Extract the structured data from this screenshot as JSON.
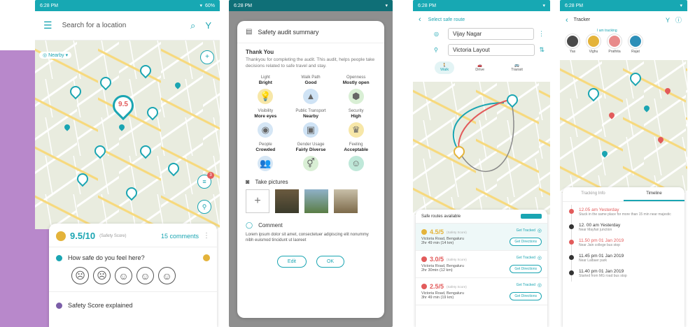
{
  "time": "6:28 PM",
  "screen1": {
    "battery": "60%",
    "search_placeholder": "Search for a location",
    "nearby_label": "Nearby",
    "score_pin": "9.5",
    "score": "9.5/10",
    "score_caption": "(Safety Score)",
    "comments": "15 comments",
    "question": "How safe do you feel here?",
    "faces": [
      "☹",
      "☹",
      "☺",
      "☺",
      "☺"
    ],
    "explained": "Safety Score explained",
    "badge_count": "3"
  },
  "screen2": {
    "title": "Safety audit summary",
    "thank_title": "Thank You",
    "thank_text": "Thankyou for completing the audit. This audit, helps people take decisions related to safe travel and stay.",
    "items": [
      {
        "label": "Light",
        "value": "Bright",
        "icon": "bulb-icon",
        "glyph": "💡",
        "bg": "#f7e7a8"
      },
      {
        "label": "Walk Path",
        "value": "Good",
        "icon": "road-icon",
        "glyph": "▲",
        "bg": "#cfe3f5"
      },
      {
        "label": "Openness",
        "value": "Mostly open",
        "icon": "hexagon-icon",
        "glyph": "⬢",
        "bg": "#d9efd5"
      },
      {
        "label": "Visibility",
        "value": "More eyes",
        "icon": "eyes-icon",
        "glyph": "◉",
        "bg": "#d5e6f5"
      },
      {
        "label": "Public Transport",
        "value": "Nearby",
        "icon": "bus-icon",
        "glyph": "▣",
        "bg": "#cfe3f5"
      },
      {
        "label": "Security",
        "value": "High",
        "icon": "guard-icon",
        "glyph": "♛",
        "bg": "#f7e7a8"
      },
      {
        "label": "People",
        "value": "Crowded",
        "icon": "people-icon",
        "glyph": "👥",
        "bg": "#d5e6f5"
      },
      {
        "label": "Gender Usage",
        "value": "Fairly Diverse",
        "icon": "gender-icon",
        "glyph": "⚥",
        "bg": "#d9efd5"
      },
      {
        "label": "Feeling",
        "value": "Acceptable",
        "icon": "smile-icon",
        "glyph": "☺",
        "bg": "#bfe8d9"
      }
    ],
    "pictures_label": "Take pictures",
    "comment_label": "Comment",
    "comment_text": "Lorem ipsum dolor sit amet, consectetuer adipiscing elit nonummy nibh euismod tincidunt ut laoreet",
    "edit": "Edit",
    "ok": "OK"
  },
  "screen3": {
    "title": "Select safe route",
    "from": "Vijay Nagar",
    "to": "Victoria Layout",
    "modes": [
      "Walk",
      "Drive",
      "Transit"
    ],
    "routes_header": "Safe routes available",
    "routes": [
      {
        "score": "4.5/5",
        "caption": "(Safety Score)",
        "road": "Victoria Road, Bengaluru",
        "time": "2hr 49 min (14 km)",
        "color": "#e4b33a"
      },
      {
        "score": "3.0/5",
        "caption": "(Safety Score)",
        "road": "Victoria Road, Bengaluru",
        "time": "2hr 30min (12 km)",
        "color": "#e25b5b"
      },
      {
        "score": "2.5/5",
        "caption": "(Safety Score)",
        "road": "Victoria Road, Bengaluru",
        "time": "3hr 49 min (19 km)",
        "color": "#e25b5b"
      }
    ],
    "tracked": "Get Tracked",
    "directions": "Get Directions"
  },
  "screen4": {
    "title": "Tracker",
    "tracking_label": "I am tracking",
    "people": [
      {
        "name": "Yas",
        "bg": "#4a4a4a"
      },
      {
        "name": "Vighu",
        "bg": "#e4b33a"
      },
      {
        "name": "Prathita",
        "bg": "#e88a8a"
      },
      {
        "name": "Rajat",
        "bg": "#2d8fb8"
      }
    ],
    "tabs": [
      "Tracking Info",
      "Timeline"
    ],
    "timeline": [
      {
        "time": "12.05 am Yesterday",
        "desc": "Stuck in the same place for more than 15 min near majestic",
        "color": "#e25b5b"
      },
      {
        "time": "12. 00 am Yesterday",
        "desc": "Near Mayfair junction",
        "color": "#333"
      },
      {
        "time": "11.50 pm 01 Jan 2019",
        "desc": "Near Jain college bus stop",
        "color": "#e25b5b"
      },
      {
        "time": "11.45 pm 01 Jan 2019",
        "desc": "Near Lalbaer park",
        "color": "#333"
      },
      {
        "time": "11.40 pm 01 Jan 2019",
        "desc": "Started from MG road bus stop",
        "color": "#333"
      }
    ]
  }
}
